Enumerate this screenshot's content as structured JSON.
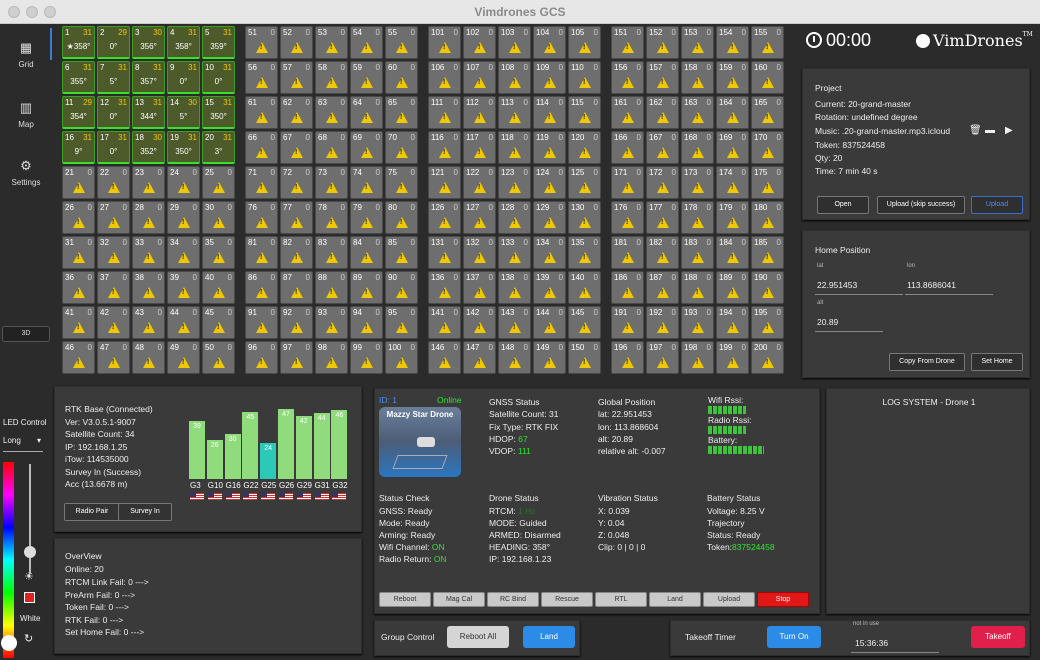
{
  "window": {
    "title": "Vimdrones GCS"
  },
  "sidebar": {
    "items": [
      {
        "label": "Grid",
        "icon": "grid-icon"
      },
      {
        "label": "Map",
        "icon": "map-icon"
      },
      {
        "label": "Settings",
        "icon": "gear-icon"
      }
    ],
    "btn3d": "3D",
    "led_title": "LED Control",
    "led_mode": "Long",
    "led_color": "White"
  },
  "grid": {
    "active": [
      {
        "id": "1",
        "q": "31",
        "h": "358°"
      },
      {
        "id": "2",
        "q": "29",
        "h": "0°"
      },
      {
        "id": "3",
        "q": "30",
        "h": "356°"
      },
      {
        "id": "4",
        "q": "31",
        "h": "358°"
      },
      {
        "id": "5",
        "q": "31",
        "h": "359°"
      },
      {
        "id": "6",
        "q": "31",
        "h": "355°"
      },
      {
        "id": "7",
        "q": "31",
        "h": "5°"
      },
      {
        "id": "8",
        "q": "31",
        "h": "357°"
      },
      {
        "id": "9",
        "q": "31",
        "h": "0°"
      },
      {
        "id": "10",
        "q": "31",
        "h": "0°"
      },
      {
        "id": "11",
        "q": "29",
        "h": "354°"
      },
      {
        "id": "12",
        "q": "31",
        "h": "0°"
      },
      {
        "id": "13",
        "q": "31",
        "h": "344°"
      },
      {
        "id": "14",
        "q": "30",
        "h": "5°"
      },
      {
        "id": "15",
        "q": "31",
        "h": "350°"
      },
      {
        "id": "16",
        "q": "31",
        "h": "9°"
      },
      {
        "id": "17",
        "q": "31",
        "h": "0°"
      },
      {
        "id": "18",
        "q": "30",
        "h": "352°"
      },
      {
        "id": "19",
        "q": "31",
        "h": "350°"
      },
      {
        "id": "20",
        "q": "31",
        "h": "3°"
      }
    ],
    "inactive_q": "0",
    "inactive_count": 200
  },
  "timer": {
    "value": "00:00"
  },
  "logo": {
    "text": "VimDrones",
    "tm": "TM"
  },
  "project": {
    "title": "Project",
    "current": "Current: 20-grand-master",
    "rotation": "Rotation: undefined degree",
    "music": "Music: .20-grand-master.mp3.icloud",
    "token": "Token: 837524458",
    "qty": "Qty: 20",
    "time": "Time: 7 min 40 s",
    "open": "Open",
    "upload_skip": "Upload (skip success)",
    "upload": "Upload"
  },
  "home": {
    "title": "Home Position",
    "lat_label": "lat",
    "lat": "22.951453",
    "lon_label": "lon",
    "lon": "113.8686041",
    "alt_label": "alt",
    "alt": "20.89",
    "copy": "Copy From Drone",
    "set": "Set Home"
  },
  "rtk": {
    "lines": [
      "RTK Base (Connected)",
      "Ver: V3.0.5.1-9007",
      "Satellite Count: 34",
      "IP: 192.168.1.25",
      "iTow: 114535000",
      "Survey In (Success)",
      "Acc (13.6678 m)"
    ],
    "radio_pair": "Radio Pair",
    "survey_in": "Survey In",
    "bars": [
      {
        "g": "G3",
        "v": 39,
        "c": "#90db7c"
      },
      {
        "g": "G10",
        "v": 26,
        "c": "#90db7c"
      },
      {
        "g": "G16",
        "v": 30,
        "c": "#90db7c"
      },
      {
        "g": "G22",
        "v": 45,
        "c": "#90db7c"
      },
      {
        "g": "G25",
        "v": 24,
        "c": "#2cc9b8"
      },
      {
        "g": "G26",
        "v": 47,
        "c": "#90db7c"
      },
      {
        "g": "G29",
        "v": 42,
        "c": "#90db7c"
      },
      {
        "g": "G31",
        "v": 44,
        "c": "#90db7c"
      },
      {
        "g": "G32",
        "v": 46,
        "c": "#90db7c"
      }
    ]
  },
  "overview": {
    "title": "OverView",
    "online": "Online: 20",
    "lines": [
      "RTCM Link Fail: 0 --->",
      "PreArm Fail: 0 --->",
      "Token Fail: 0 --->",
      "RTK Fail: 0 --->",
      "Set Home Fail: 0 --->"
    ]
  },
  "drone": {
    "id": "ID: 1",
    "status": "Online",
    "name": "Mazzy Star Drone",
    "gnss_title": "GNSS Status",
    "sat": "Satellite Count: 31",
    "fix": "Fix Type: RTK FIX",
    "hdop_l": "HDOP: ",
    "hdop": "67",
    "vdop_l": "VDOP: ",
    "vdop": "111",
    "gp_title": "Global Position",
    "lat": "lat: 22.951453",
    "lon": "lon: 113.868604",
    "alt": "alt: 20.89",
    "ralt": "relative alt: -0.007",
    "wifi": "Wifi Rssi:",
    "radio": "Radio Rssi:",
    "battery": "Battery:",
    "sc_title": "Status Check",
    "gnss": "GNSS: Ready",
    "mode": "Mode: Ready",
    "arming": "Arming: Ready",
    "wifich_l": "Wifi Channel: ",
    "wifich": "ON",
    "radioret_l": "Radio Return: ",
    "radioret": "ON",
    "ds_title": "Drone Status",
    "rtcm_l": "RTCM: ",
    "rtcm": "1 Hz",
    "dmode": "MODE: Guided",
    "armed": "ARMED: Disarmed",
    "heading": "HEADING: 358°",
    "ip": "IP: 192.168.1.23",
    "vs_title": "Vibration Status",
    "vx": "X: 0.039",
    "vy": "Y: 0.04",
    "vz": "Z: 0.048",
    "clip": "Clip: 0 | 0 | 0",
    "bs_title": "Battery Status",
    "voltage": "Voltage: 8.25 V",
    "traj": "Trajectory",
    "bstatus": "Status: Ready",
    "token_l": "Token:",
    "token": "837524458",
    "buttons": [
      "Reboot",
      "Mag Cal",
      "RC Bind",
      "Rescue",
      "RTL",
      "Land",
      "Upload",
      "Stop"
    ]
  },
  "log": {
    "title": "LOG SYSTEM - Drone 1"
  },
  "group": {
    "title": "Group Control",
    "reboot": "Reboot All",
    "land": "Land"
  },
  "takeoff": {
    "title": "Takeoff Timer",
    "turn_on": "Turn On",
    "not_in_use": "not in use",
    "time": "15:36:36",
    "takeoff": "Takeoff"
  }
}
